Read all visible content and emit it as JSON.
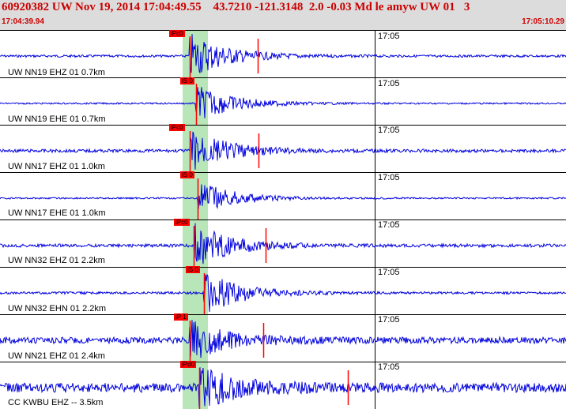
{
  "header": {
    "title": "60920382 UW Nov 19, 2014 17:04:49.55    43.7210 -121.3148  2.0 -0.03 Md le amyw UW 01   3",
    "start_time": "17:04:39.94",
    "end_time": "17:05:10.29"
  },
  "colors": {
    "header_bg": "#dcdcdc",
    "header_text": "#cc0000",
    "trace": "#0000dd",
    "pick": "#ff0000",
    "window_band": "#b8e6b8"
  },
  "traces": [
    {
      "label": "UW NN19 EHZ 01 0.7km",
      "pick": "iPc0",
      "time_tick": "17:05"
    },
    {
      "label": "UW NN19 EHE 01 0.7km",
      "pick": "iS 0",
      "time_tick": "17:05"
    },
    {
      "label": "UW NN17 EHZ 01 1.0km",
      "pick": "iPc0",
      "time_tick": "17:05"
    },
    {
      "label": "UW NN17 EHE 01 1.0km",
      "pick": "iS 0",
      "time_tick": "17:05"
    },
    {
      "label": "UW NN32 EHZ 01 2.2km",
      "pick": "iPc0",
      "time_tick": "17:05"
    },
    {
      "label": "UW NN32 EHN 01 2.2km",
      "pick": "iS 0",
      "time_tick": "17:05"
    },
    {
      "label": "UW NN21 EHZ 01 2.4km",
      "pick": "iP 1",
      "time_tick": "17:05"
    },
    {
      "label": "CC KWBU EHZ -- 3.5km",
      "pick": "iPd0",
      "time_tick": "17:05"
    }
  ]
}
